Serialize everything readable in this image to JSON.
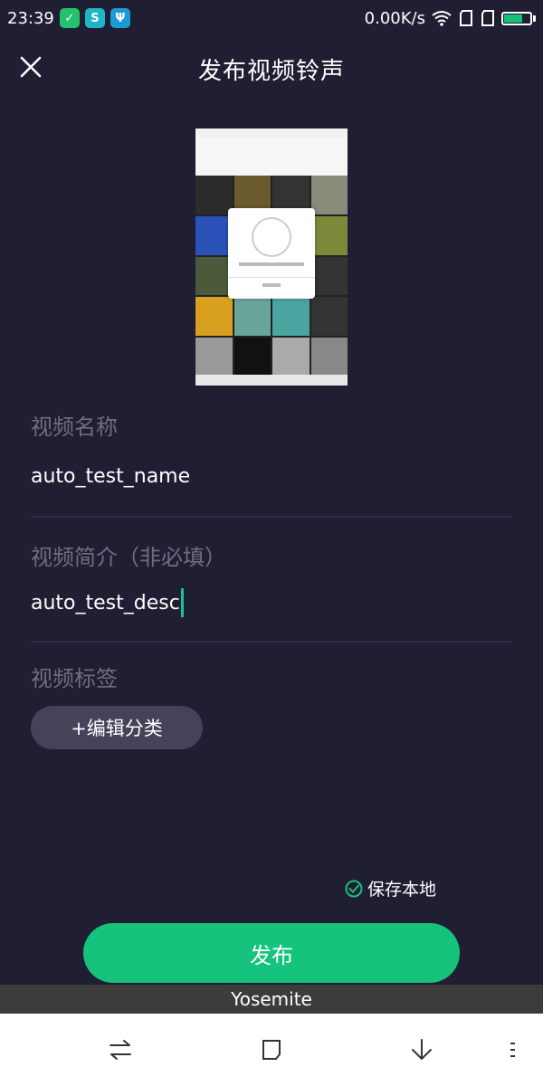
{
  "status_bar": {
    "time": "23:39",
    "net_speed": "0.00K/s",
    "battery_level": 0.7
  },
  "header": {
    "title": "发布视频铃声",
    "close_icon": "close-icon"
  },
  "form": {
    "name_label": "视频名称",
    "name_value": "auto_test_name",
    "desc_label": "视频简介（非必填）",
    "desc_value": "auto_test_desc",
    "tag_label": "视频标签",
    "tag_button_label": "+编辑分类"
  },
  "save_local": {
    "label": "保存本地",
    "checked": true
  },
  "publish_button": {
    "label": "发布"
  },
  "toast": {
    "text": "Yosemite"
  },
  "colors": {
    "background": "#1f1e33",
    "accent": "#15c37d",
    "label_gray": "#6e6d82",
    "tag_button": "#44435a"
  },
  "icons": {
    "nav_back": "swap-arrows-icon",
    "nav_home": "square-icon",
    "nav_down": "arrow-down-icon",
    "nav_menu": "menu-dots-icon"
  }
}
